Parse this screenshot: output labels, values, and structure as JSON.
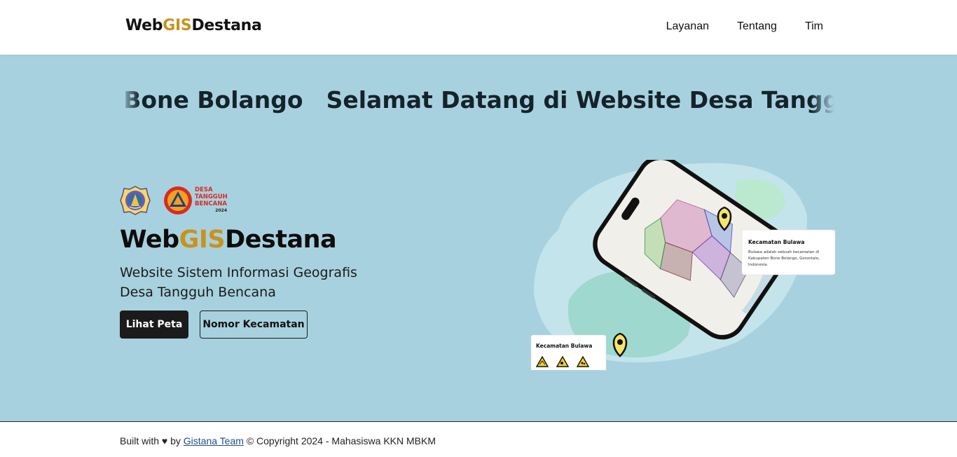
{
  "nav": {
    "brand": {
      "part1": "Web",
      "part2": "GIS",
      "part3": "Destana"
    },
    "links": [
      "Layanan",
      "Tentang",
      "Tim"
    ]
  },
  "hero": {
    "marquee_text": "Selamat Datang di Website Desa Tangguh Bencana Kabupaten Bone Bolango",
    "logo_badge": {
      "line1": "DESA",
      "line2": "TANGGUH",
      "line3": "BENCANA",
      "year": "2024"
    },
    "title": {
      "part1": "Web",
      "part2": "GIS",
      "part3": "Destana"
    },
    "subtitle": "Website Sistem Informasi Geografis Desa Tangguh Bencana",
    "buttons": {
      "primary": "Lihat Peta",
      "secondary": "Nomor Kecamatan"
    },
    "illustration": {
      "card_top": {
        "title": "Kecamatan Bulawa",
        "text": "Bulawa adalah sebuah kecamatan di Kabupaten Bone Bolango, Gorontalo, Indonesia."
      },
      "card_bottom": {
        "title": "Kecamatan Bulawa"
      }
    }
  },
  "footer": {
    "prefix": "Built with ♥ by",
    "link": "Gistana Team",
    "suffix": "© Copyright 2024 - Mahasiswa KKN MBKM"
  },
  "colors": {
    "accent": "#c9921d",
    "hero_bg": "#a8d1df",
    "dark": "#1b1b1b"
  }
}
